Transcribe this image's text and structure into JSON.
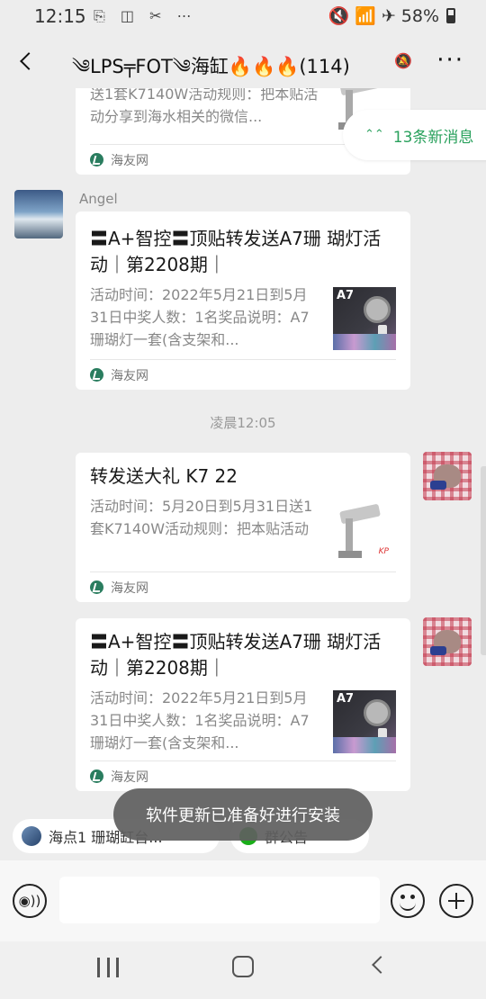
{
  "status_bar": {
    "time": "12:15",
    "left_icons": "⎘ ◫ ✂ ⋯",
    "right_icons": "🔇 📶 ✈",
    "battery_percent": "58%"
  },
  "header": {
    "title": "༄LPS╤FOT༄海缸🔥🔥🔥(114)",
    "mute_icon": "🔕",
    "more": "···"
  },
  "new_messages": {
    "chevron": "⌃⌃",
    "label": "13条新消息"
  },
  "messages": [
    {
      "sender": "",
      "card": {
        "title": "",
        "desc": "送1套K7140W活动规则：把本贴活动分享到海水相关的微信...",
        "source": "海友网"
      }
    },
    {
      "sender": "Angel",
      "card": {
        "title": "〓A+智控〓顶贴转发送A7珊 瑚灯活动｜第2208期｜",
        "desc": "活动时间：2022年5月21日到5月31日中奖人数：1名奖品说明：A7珊瑚灯一套(含支架和...",
        "thumb_label": "A7",
        "source": "海友网"
      }
    },
    {
      "timestamp": "凌晨12:05"
    },
    {
      "sender": "",
      "card": {
        "title": "转发送大礼 K7 22",
        "desc": "活动时间：5月20日到5月31日送1套K7140W活动规则：把本贴活动分享到海水相关的微信...",
        "thumb_logo": "KP",
        "source": "海友网"
      }
    },
    {
      "sender": "",
      "card": {
        "title": "〓A+智控〓顶贴转发送A7珊 瑚灯活动｜第2208期｜",
        "desc": "活动时间：2022年5月21日到5月31日中奖人数：1名奖品说明：A7珊瑚灯一套(含支架和...",
        "thumb_label": "A7",
        "source": "海友网"
      }
    }
  ],
  "quick_bar": {
    "chip1": "海点1 珊瑚缸台...",
    "chip2": "群公告"
  },
  "toast": "软件更新已准备好进行安装",
  "input_bar": {
    "voice_icon": "◉))",
    "placeholder": ""
  }
}
